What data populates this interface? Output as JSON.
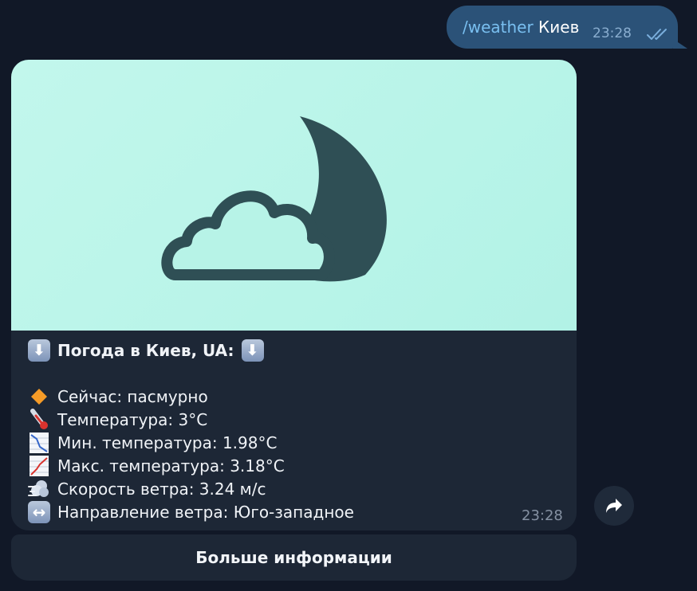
{
  "outgoing_message": {
    "command": "/weather",
    "argument": " Киев",
    "time": "23:28",
    "status_icon": "double-check-icon"
  },
  "incoming_message": {
    "image_icon": "cloud-moon-icon",
    "title": "Погода в Киев, UA:",
    "title_icon": "down-arrow-icon",
    "lines": [
      {
        "icon": "orange-diamond-icon",
        "text": "Сейчас: пасмурно"
      },
      {
        "icon": "thermometer-icon",
        "text": "Температура: 3°C"
      },
      {
        "icon": "chart-decreasing-icon",
        "text": "Мин. температура: 1.98°C"
      },
      {
        "icon": "chart-increasing-icon",
        "text": "Макс. температура: 3.18°C"
      },
      {
        "icon": "wind-icon",
        "text": "Скорость ветра: 3.24 м/с"
      },
      {
        "icon": "left-right-arrow-icon",
        "text": "Направление ветра: Юго-западное"
      }
    ],
    "time": "23:28"
  },
  "inline_button": {
    "label": "Больше информации"
  },
  "forward_button": {
    "icon": "forward-arrow-icon"
  },
  "colors": {
    "background": "#111827",
    "outgoing_bubble": "#2b5278",
    "incoming_bubble": "#1d2736",
    "command_link": "#79bff0",
    "image_background": "#b6f4e8",
    "icon_dark": "#2f4f55"
  }
}
